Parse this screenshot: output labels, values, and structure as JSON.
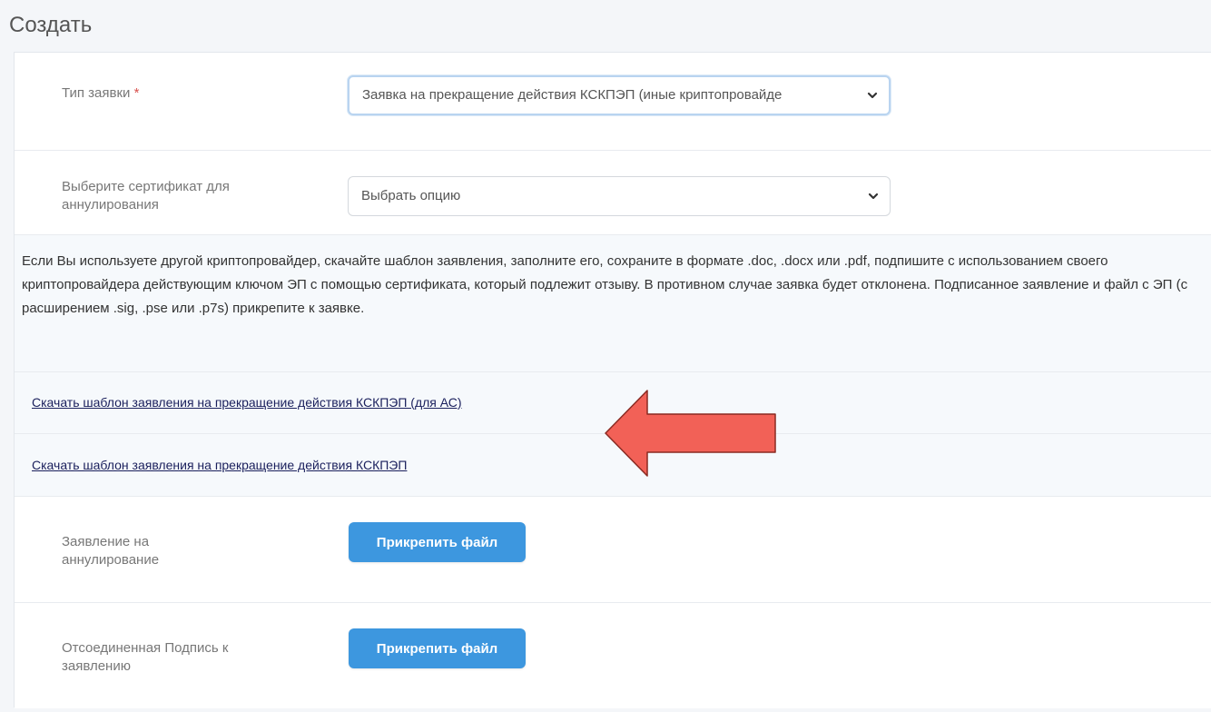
{
  "page": {
    "title": "Создать"
  },
  "form": {
    "request_type": {
      "label": "Тип заявки",
      "required_mark": "*",
      "value": "Заявка на прекращение действия КСКПЭП (иные криптопровайде"
    },
    "certificate": {
      "label": "Выберите сертификат для аннулирования",
      "value": "Выбрать опцию"
    },
    "info_text": "Если Вы используете другой криптопровайдер, скачайте шаблон заявления, заполните его, сохраните в формате .doc, .docx или .pdf, подпишите с использованием своего криптопровайдера действующим ключом ЭП с помощью сертификата, который подлежит отзыву. В противном случае заявка будет отклонена. Подписанное заявление и файл с ЭП (с расширением .sig, .pse или .p7s) прикрепите к заявке.",
    "link_template_as": "Скачать шаблон заявления на прекращение действия КСКПЭП (для АС)",
    "link_template": "Скачать шаблон заявления на прекращение действия КСКПЭП",
    "statement": {
      "label": "Заявление на аннулирование",
      "button": "Прикрепить файл"
    },
    "signature": {
      "label": "Отсоединенная Подпись к заявлению",
      "button": "Прикрепить файл"
    }
  },
  "annotation": {
    "arrow_color": "#f26157",
    "arrow_stroke": "#8a2a22",
    "icon": "left-arrow-icon"
  },
  "colors": {
    "button_bg": "#3d97df",
    "link": "#1a1f5c",
    "required": "#d9534f"
  }
}
